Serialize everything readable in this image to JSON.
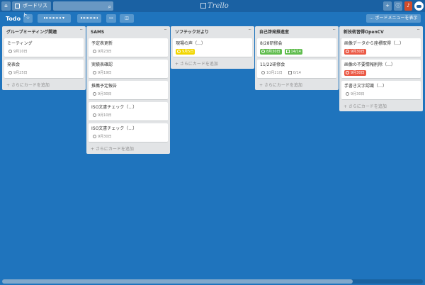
{
  "topbar": {
    "boards_label": "ボードリスト",
    "search_placeholder": "",
    "logo_text": "Trello"
  },
  "board": {
    "title": "Todo",
    "team_label": "······",
    "visibility_label": "······",
    "menu_label": "ボードメニューを表示"
  },
  "add_card_label": "+ さらにカードを追加",
  "lists": [
    {
      "title": "グループミーティング関連",
      "cards": [
        {
          "title": "ミーティング",
          "due": "9月10日"
        },
        {
          "title": "発表会",
          "due": "9月25日"
        }
      ]
    },
    {
      "title": "SAMS",
      "cards": [
        {
          "title": "予定表更新",
          "due": "9月23日"
        },
        {
          "title": "実績表確認",
          "due": "9月19日"
        },
        {
          "title": "推薦予定報告",
          "due": "9月30日"
        },
        {
          "title": "ISO文書チェック（…）",
          "due": "9月10日"
        },
        {
          "title": "ISO文書チェック（…）",
          "due": "9月30日"
        }
      ]
    },
    {
      "title": "ソフテックだより",
      "cards": [
        {
          "title": "現場の声（…）",
          "due": "9月5日",
          "due_color": "#f2d600"
        }
      ]
    },
    {
      "title": "自己啓発推進室",
      "cards": [
        {
          "title": "8/28研修会",
          "due": "8月30日",
          "due_color": "#61bd4f",
          "checklist": "14/14",
          "checklist_color": "#61bd4f"
        },
        {
          "title": "11/22研修会",
          "due": "10月21日",
          "checklist": "0/14"
        }
      ]
    },
    {
      "title": "新技術習得OpenCV",
      "cards": [
        {
          "title": "画像データから座標取得（…）",
          "due": "9月30日",
          "due_color": "#eb5a46"
        },
        {
          "title": "画像の不要情報削除（…）",
          "due": "9月30日",
          "due_color": "#eb5a46"
        },
        {
          "title": "手書き文字認識（…）",
          "due": "9月30日"
        }
      ]
    }
  ]
}
